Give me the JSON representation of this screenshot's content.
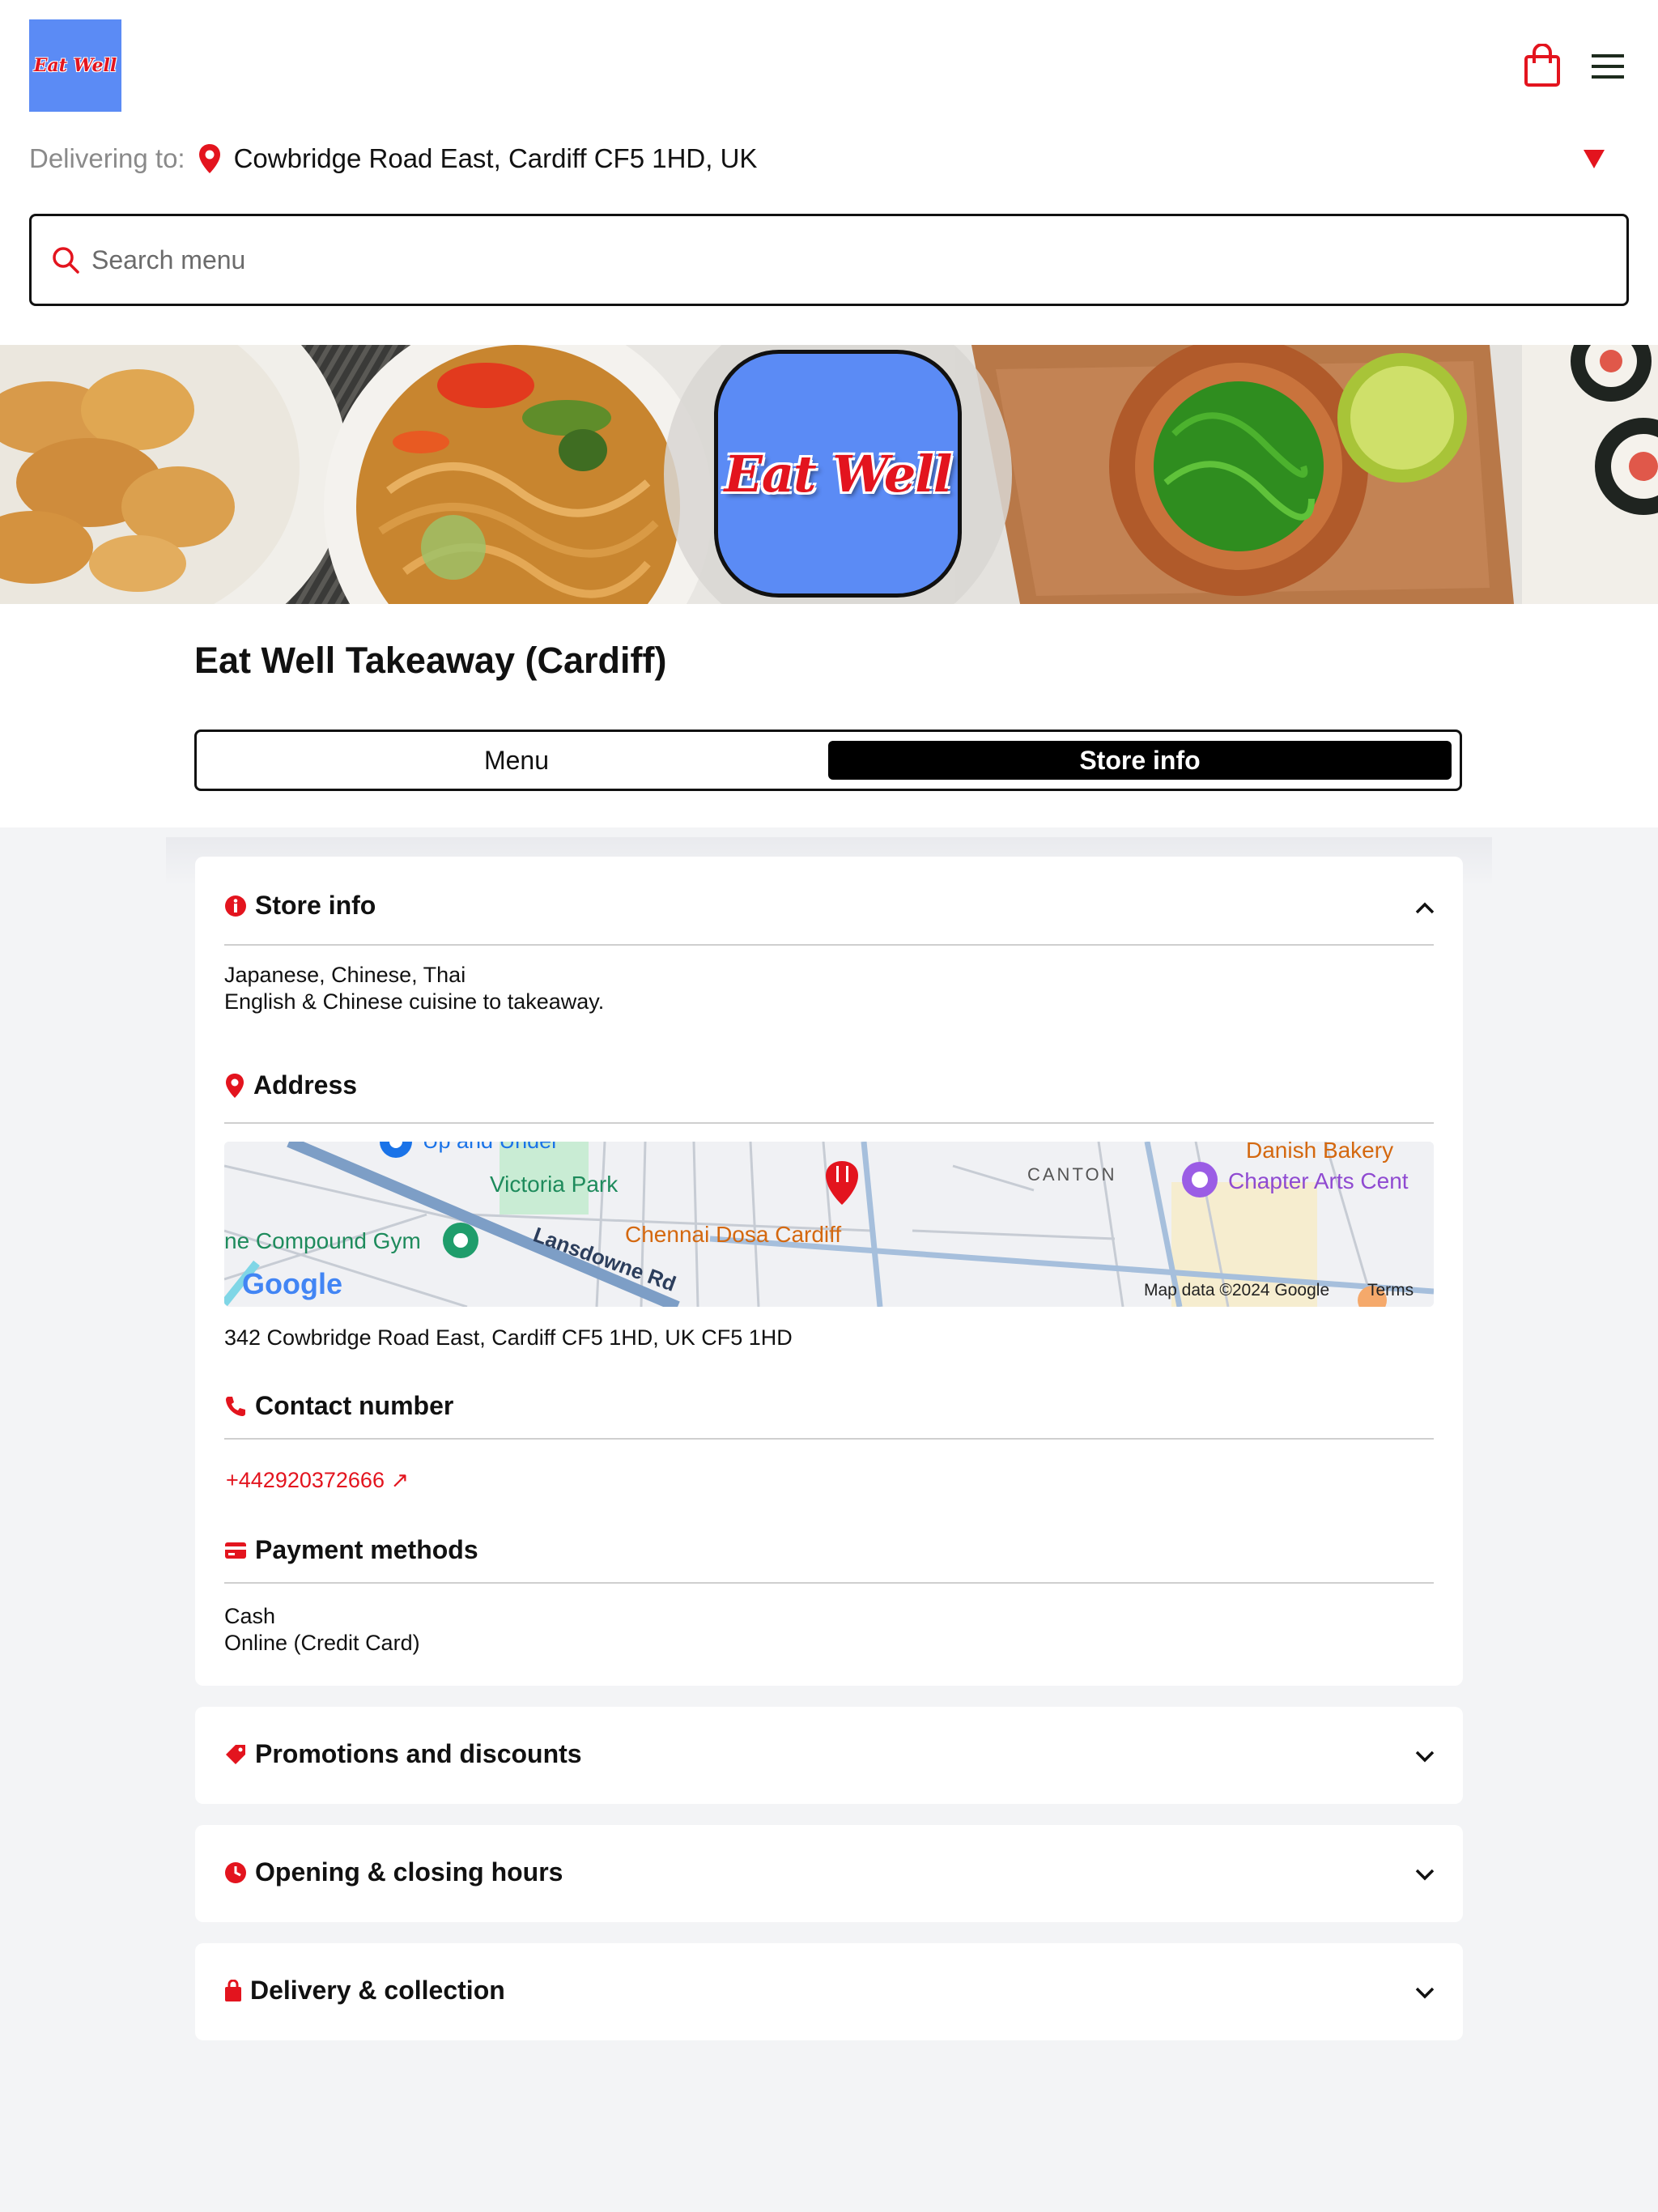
{
  "brand": {
    "logo_text": "Eat Well",
    "colors": {
      "accent": "#e3141e",
      "logo_bg": "#5b8bf5",
      "active_tab": "#000000"
    }
  },
  "header": {
    "icons": [
      "shopping-bag-icon",
      "hamburger-menu-icon"
    ],
    "delivering_label": "Delivering to:",
    "address": "Cowbridge Road East, Cardiff CF5 1HD, UK"
  },
  "search": {
    "placeholder": "Search menu"
  },
  "store": {
    "title": "Eat Well Takeaway (Cardiff)",
    "tabs": [
      {
        "label": "Menu",
        "active": false
      },
      {
        "label": "Store info",
        "active": true
      }
    ]
  },
  "info": {
    "store_info": {
      "heading": "Store info",
      "expanded": true,
      "cuisines": "Japanese, Chinese, Thai",
      "description": "English & Chinese cuisine to takeaway."
    },
    "address": {
      "heading": "Address",
      "full": "342 Cowbridge Road East, Cardiff CF5 1HD, UK CF5 1HD",
      "map": {
        "labels": {
          "up_and_under": "Up and Under",
          "victoria_park": "Victoria Park",
          "canton": "CANTON",
          "danish_bakery": "Danish Bakery",
          "chapter": "Chapter Arts Cent",
          "compound_gym": "ne Compound Gym",
          "lansdowne": "Lansdowne Rd",
          "chennai": "Chennai Dosa Cardiff",
          "google": "Google",
          "map_data": "Map data ©2024 Google",
          "terms": "Terms"
        }
      }
    },
    "contact": {
      "heading": "Contact number",
      "phone": "+442920372666 ↗"
    },
    "payment": {
      "heading": "Payment methods",
      "methods": [
        "Cash",
        "Online (Credit Card)"
      ]
    }
  },
  "sections": [
    {
      "heading": "Promotions and discounts",
      "icon": "tag-icon"
    },
    {
      "heading": "Opening & closing hours",
      "icon": "clock-icon"
    },
    {
      "heading": "Delivery & collection",
      "icon": "bag-icon"
    }
  ]
}
